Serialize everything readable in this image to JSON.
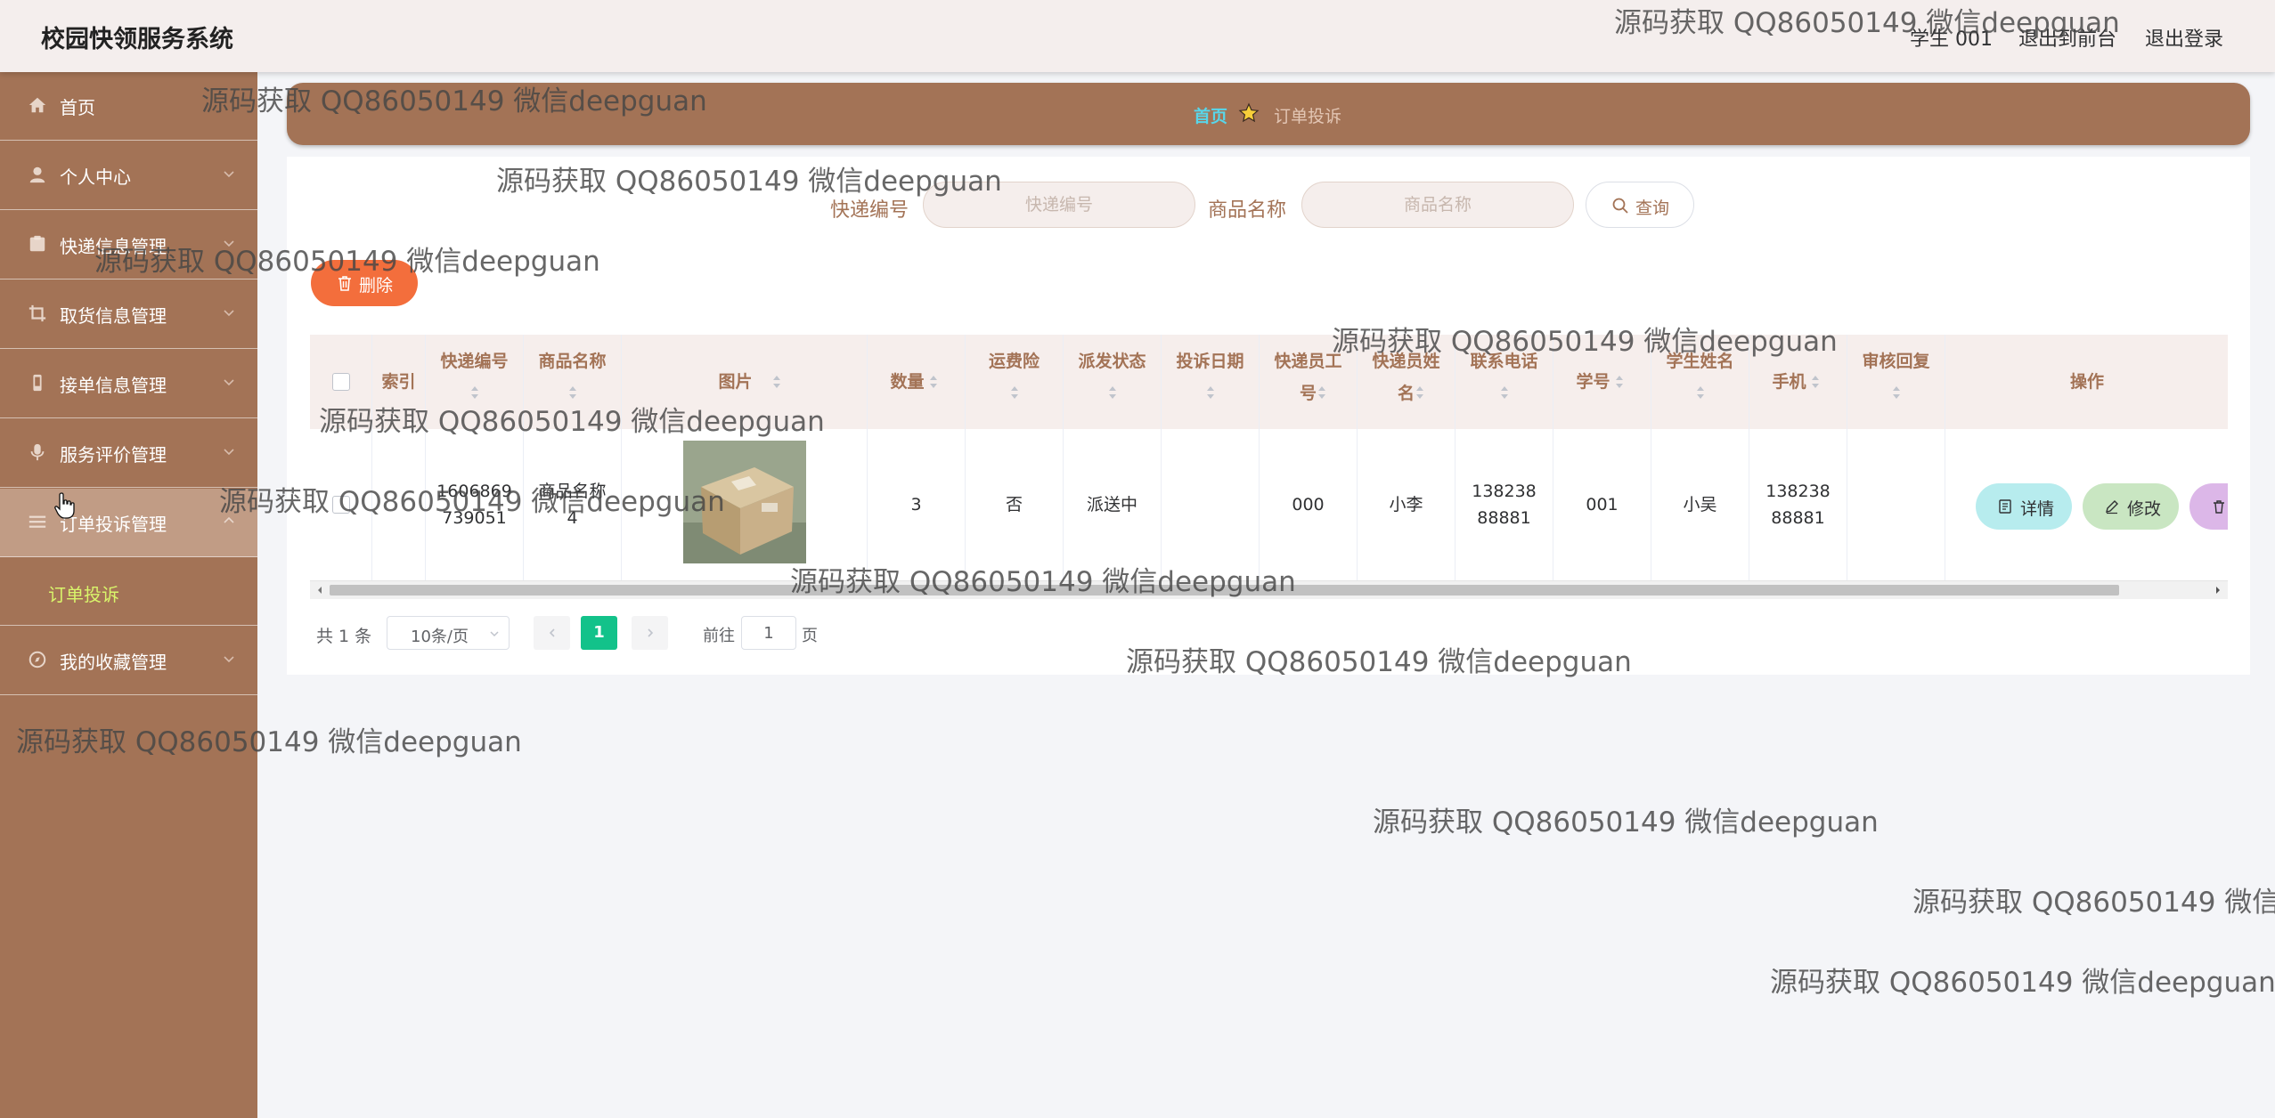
{
  "header": {
    "title": "校园快领服务系统",
    "user": "学生 001",
    "front_link": "退出到前台",
    "logout_link": "退出登录"
  },
  "sidebar": {
    "items": [
      {
        "label": "首页",
        "icon": "home-icon"
      },
      {
        "label": "个人中心",
        "icon": "user-icon"
      },
      {
        "label": "快递信息管理",
        "icon": "package-icon"
      },
      {
        "label": "取货信息管理",
        "icon": "crop-icon"
      },
      {
        "label": "接单信息管理",
        "icon": "phone-icon"
      },
      {
        "label": "服务评价管理",
        "icon": "microphone-icon"
      },
      {
        "label": "订单投诉管理",
        "icon": "list-icon"
      },
      {
        "label": "我的收藏管理",
        "icon": "compass-icon"
      }
    ],
    "active_submenu": "订单投诉"
  },
  "breadcrumb": {
    "home": "首页",
    "current": "订单投诉"
  },
  "search": {
    "field1_label": "快递编号",
    "field1_placeholder": "快递编号",
    "field1_value": "",
    "field2_label": "商品名称",
    "field2_placeholder": "商品名称",
    "field2_value": "",
    "query_button": "查询"
  },
  "toolbar": {
    "delete_button": "删除"
  },
  "table": {
    "columns": [
      "索引",
      "快递编号",
      "商品名称",
      "图片",
      "数量",
      "运费险",
      "派发状态",
      "投诉日期",
      "快递员工号",
      "快递员姓名",
      "联系电话",
      "学号",
      "学生姓名",
      "手机",
      "审核回复",
      "操作"
    ],
    "rows": [
      {
        "index": "",
        "express_no": "1606869739051",
        "product_name": "商品名称4",
        "image": "package-photo",
        "quantity": "3",
        "insurance": "否",
        "status": "派送中",
        "complaint_date": "",
        "courier_id": "000",
        "courier_name": "小李",
        "contact_phone": "13823888881",
        "student_no": "001",
        "student_name": "小吴",
        "mobile": "13823888881",
        "review_reply": "",
        "actions": {
          "detail": "详情",
          "edit": "修改"
        }
      }
    ]
  },
  "pagination": {
    "total": "共 1 条",
    "page_size": "10条/页",
    "current_page": "1",
    "goto_label": "前往",
    "goto_value": "1",
    "page_suffix": "页"
  },
  "watermark_text": "源码获取 QQ86050149 微信deepguan",
  "colors": {
    "sidebar_bg": "#a37356",
    "header_bg": "#f4eeed",
    "accent": "#a37356",
    "submenu_active": "#d9f56b",
    "delete_button": "#f36e3c",
    "page_active": "#13c28a",
    "detail_button": "#b7ecee",
    "edit_button": "#c9e6c2",
    "remove_button": "#dcb7e8"
  }
}
